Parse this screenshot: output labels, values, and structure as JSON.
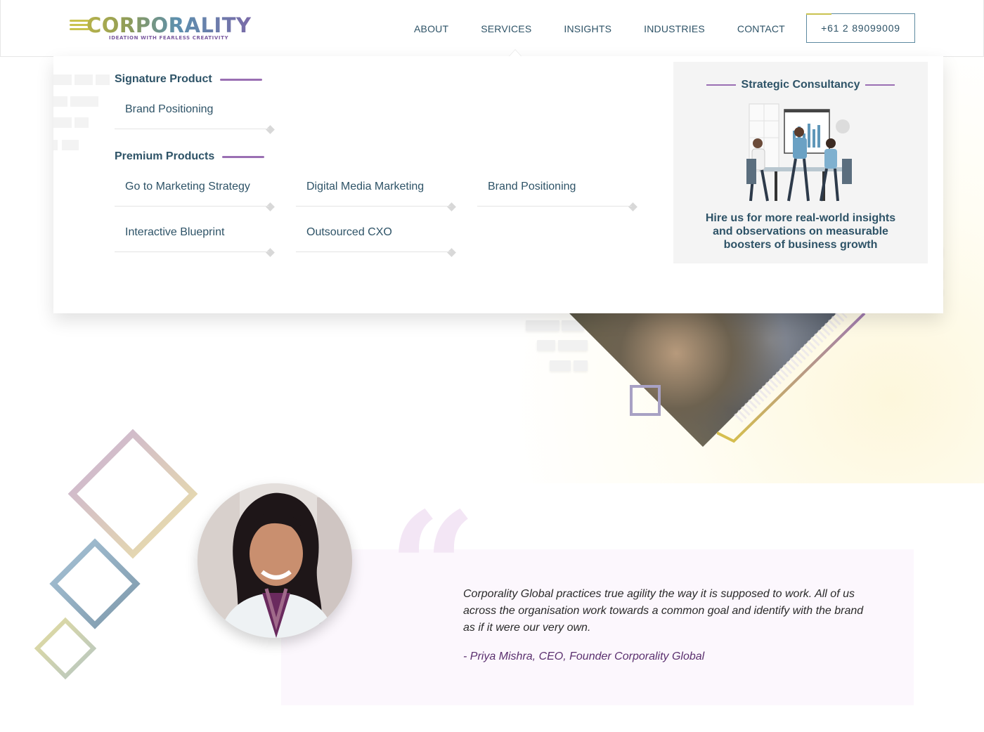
{
  "header": {
    "logo_text": "CORPORALITY",
    "logo_tagline": "IDEATION WITH FEARLESS CREATIVITY",
    "nav": [
      {
        "label": "ABOUT"
      },
      {
        "label": "SERVICES"
      },
      {
        "label": "INSIGHTS"
      },
      {
        "label": "INDUSTRIES"
      },
      {
        "label": "CONTACT"
      }
    ],
    "phone": "+61 2 89099009"
  },
  "mega_menu": {
    "signature": {
      "title": "Signature Product",
      "items": [
        "Brand Positioning"
      ]
    },
    "premium": {
      "title": "Premium Products",
      "items": [
        "Go to Marketing Strategy",
        "Digital Media Marketing",
        "Brand Positioning",
        "Interactive Blueprint",
        "Outsourced CXO"
      ]
    },
    "promo": {
      "title": "Strategic Consultancy",
      "text": "Hire us for more real-world insights and observations on measurable boosters of business growth"
    }
  },
  "testimonial": {
    "quote": "Corporality Global practices true agility the way it is supposed to work. All of us across the organisation work towards a common goal and identify with the brand as if it were our very own.",
    "author": "- Priya Mishra, CEO, Founder Corporality Global"
  },
  "colors": {
    "primary_text": "#2e5367",
    "accent_purple": "#9a6fb3",
    "accent_yellow": "#c9c24f",
    "quote_bg": "#fcf7fd"
  }
}
